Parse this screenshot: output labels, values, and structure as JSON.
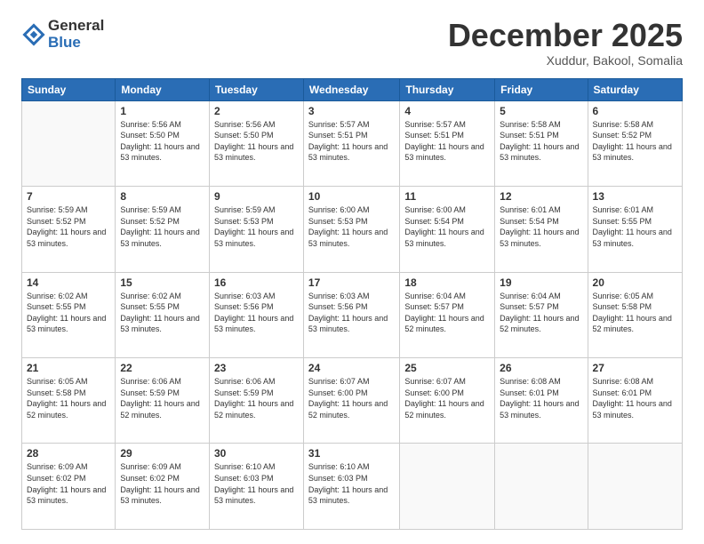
{
  "header": {
    "logo_general": "General",
    "logo_blue": "Blue",
    "month_title": "December 2025",
    "subtitle": "Xuddur, Bakool, Somalia"
  },
  "days_of_week": [
    "Sunday",
    "Monday",
    "Tuesday",
    "Wednesday",
    "Thursday",
    "Friday",
    "Saturday"
  ],
  "weeks": [
    [
      {
        "day": "",
        "info": ""
      },
      {
        "day": "1",
        "info": "Sunrise: 5:56 AM\nSunset: 5:50 PM\nDaylight: 11 hours\nand 53 minutes."
      },
      {
        "day": "2",
        "info": "Sunrise: 5:56 AM\nSunset: 5:50 PM\nDaylight: 11 hours\nand 53 minutes."
      },
      {
        "day": "3",
        "info": "Sunrise: 5:57 AM\nSunset: 5:51 PM\nDaylight: 11 hours\nand 53 minutes."
      },
      {
        "day": "4",
        "info": "Sunrise: 5:57 AM\nSunset: 5:51 PM\nDaylight: 11 hours\nand 53 minutes."
      },
      {
        "day": "5",
        "info": "Sunrise: 5:58 AM\nSunset: 5:51 PM\nDaylight: 11 hours\nand 53 minutes."
      },
      {
        "day": "6",
        "info": "Sunrise: 5:58 AM\nSunset: 5:52 PM\nDaylight: 11 hours\nand 53 minutes."
      }
    ],
    [
      {
        "day": "7",
        "info": "Sunrise: 5:59 AM\nSunset: 5:52 PM\nDaylight: 11 hours\nand 53 minutes."
      },
      {
        "day": "8",
        "info": "Sunrise: 5:59 AM\nSunset: 5:52 PM\nDaylight: 11 hours\nand 53 minutes."
      },
      {
        "day": "9",
        "info": "Sunrise: 5:59 AM\nSunset: 5:53 PM\nDaylight: 11 hours\nand 53 minutes."
      },
      {
        "day": "10",
        "info": "Sunrise: 6:00 AM\nSunset: 5:53 PM\nDaylight: 11 hours\nand 53 minutes."
      },
      {
        "day": "11",
        "info": "Sunrise: 6:00 AM\nSunset: 5:54 PM\nDaylight: 11 hours\nand 53 minutes."
      },
      {
        "day": "12",
        "info": "Sunrise: 6:01 AM\nSunset: 5:54 PM\nDaylight: 11 hours\nand 53 minutes."
      },
      {
        "day": "13",
        "info": "Sunrise: 6:01 AM\nSunset: 5:55 PM\nDaylight: 11 hours\nand 53 minutes."
      }
    ],
    [
      {
        "day": "14",
        "info": "Sunrise: 6:02 AM\nSunset: 5:55 PM\nDaylight: 11 hours\nand 53 minutes."
      },
      {
        "day": "15",
        "info": "Sunrise: 6:02 AM\nSunset: 5:55 PM\nDaylight: 11 hours\nand 53 minutes."
      },
      {
        "day": "16",
        "info": "Sunrise: 6:03 AM\nSunset: 5:56 PM\nDaylight: 11 hours\nand 53 minutes."
      },
      {
        "day": "17",
        "info": "Sunrise: 6:03 AM\nSunset: 5:56 PM\nDaylight: 11 hours\nand 53 minutes."
      },
      {
        "day": "18",
        "info": "Sunrise: 6:04 AM\nSunset: 5:57 PM\nDaylight: 11 hours\nand 52 minutes."
      },
      {
        "day": "19",
        "info": "Sunrise: 6:04 AM\nSunset: 5:57 PM\nDaylight: 11 hours\nand 52 minutes."
      },
      {
        "day": "20",
        "info": "Sunrise: 6:05 AM\nSunset: 5:58 PM\nDaylight: 11 hours\nand 52 minutes."
      }
    ],
    [
      {
        "day": "21",
        "info": "Sunrise: 6:05 AM\nSunset: 5:58 PM\nDaylight: 11 hours\nand 52 minutes."
      },
      {
        "day": "22",
        "info": "Sunrise: 6:06 AM\nSunset: 5:59 PM\nDaylight: 11 hours\nand 52 minutes."
      },
      {
        "day": "23",
        "info": "Sunrise: 6:06 AM\nSunset: 5:59 PM\nDaylight: 11 hours\nand 52 minutes."
      },
      {
        "day": "24",
        "info": "Sunrise: 6:07 AM\nSunset: 6:00 PM\nDaylight: 11 hours\nand 52 minutes."
      },
      {
        "day": "25",
        "info": "Sunrise: 6:07 AM\nSunset: 6:00 PM\nDaylight: 11 hours\nand 52 minutes."
      },
      {
        "day": "26",
        "info": "Sunrise: 6:08 AM\nSunset: 6:01 PM\nDaylight: 11 hours\nand 53 minutes."
      },
      {
        "day": "27",
        "info": "Sunrise: 6:08 AM\nSunset: 6:01 PM\nDaylight: 11 hours\nand 53 minutes."
      }
    ],
    [
      {
        "day": "28",
        "info": "Sunrise: 6:09 AM\nSunset: 6:02 PM\nDaylight: 11 hours\nand 53 minutes."
      },
      {
        "day": "29",
        "info": "Sunrise: 6:09 AM\nSunset: 6:02 PM\nDaylight: 11 hours\nand 53 minutes."
      },
      {
        "day": "30",
        "info": "Sunrise: 6:10 AM\nSunset: 6:03 PM\nDaylight: 11 hours\nand 53 minutes."
      },
      {
        "day": "31",
        "info": "Sunrise: 6:10 AM\nSunset: 6:03 PM\nDaylight: 11 hours\nand 53 minutes."
      },
      {
        "day": "",
        "info": ""
      },
      {
        "day": "",
        "info": ""
      },
      {
        "day": "",
        "info": ""
      }
    ]
  ]
}
